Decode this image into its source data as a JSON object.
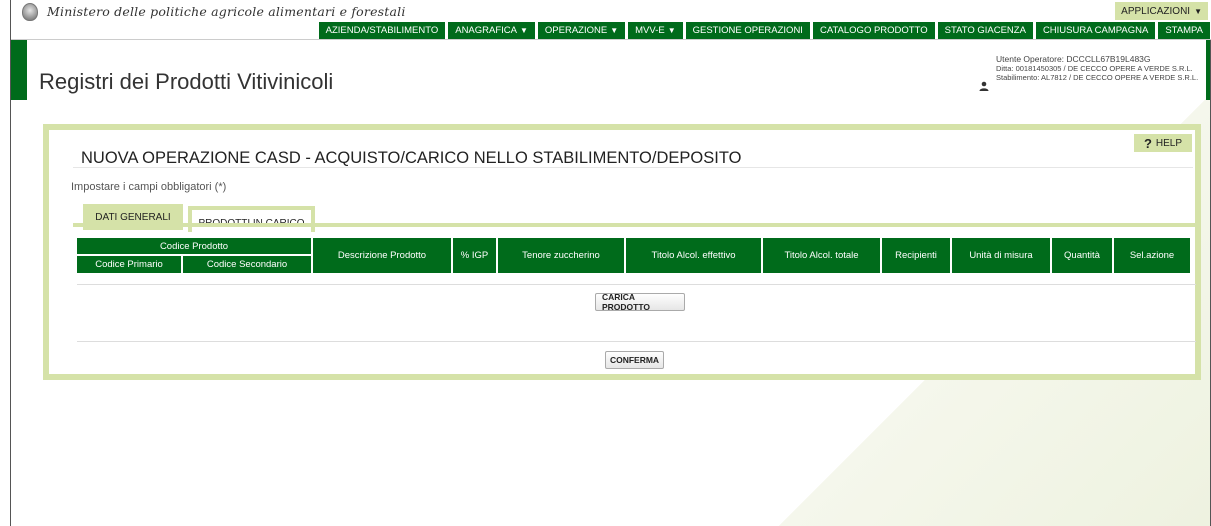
{
  "header": {
    "ministry": "Ministero delle politiche agricole alimentari e forestali",
    "applicazioni": "APPLICAZIONI",
    "nav": [
      {
        "label": "AZIENDA/STABILIMENTO",
        "dropdown": false
      },
      {
        "label": "ANAGRAFICA",
        "dropdown": true
      },
      {
        "label": "OPERAZIONE",
        "dropdown": true
      },
      {
        "label": "MVV-E",
        "dropdown": true
      },
      {
        "label": "GESTIONE OPERAZIONI",
        "dropdown": false
      },
      {
        "label": "CATALOGO PRODOTTO",
        "dropdown": false
      },
      {
        "label": "STATO GIACENZA",
        "dropdown": false
      },
      {
        "label": "CHIUSURA CAMPAGNA",
        "dropdown": false
      },
      {
        "label": "STAMPA",
        "dropdown": false
      }
    ]
  },
  "page": {
    "title": "Registri dei Prodotti Vitivinicoli"
  },
  "user": {
    "operator": "Utente Operatore: DCCCLL67B19L483G",
    "ditta": "Ditta: 00181450305 / DE CECCO OPERE A VERDE S.R.L.",
    "stabilimento": "Stabilimento: AL7812 / DE CECCO OPERE A VERDE S.R.L."
  },
  "panel": {
    "help": "HELP",
    "help_mark": "?",
    "title": "NUOVA OPERAZIONE CASD - ACQUISTO/CARICO NELLO STABILIMENTO/DEPOSITO",
    "required_note": "Impostare i campi obbligatori (*)",
    "tabs": {
      "dati": "DATI GENERALI",
      "prodotti": "PRODOTTI IN CARICO"
    },
    "table": {
      "group": "Codice Prodotto",
      "primario": "Codice Primario",
      "secondario": "Codice Secondario",
      "columns": [
        "Descrizione Prodotto",
        "% IGP",
        "Tenore zuccherino",
        "Titolo Alcol. effettivo",
        "Titolo Alcol. totale",
        "Recipienti",
        "Unità di misura",
        "Quantità",
        "Sel.azione"
      ]
    },
    "carica_button": "CARICA PRODOTTO",
    "conferma_button": "CONFERMA"
  },
  "colors": {
    "green": "#006b1b",
    "light_green": "#d5e2a8"
  }
}
